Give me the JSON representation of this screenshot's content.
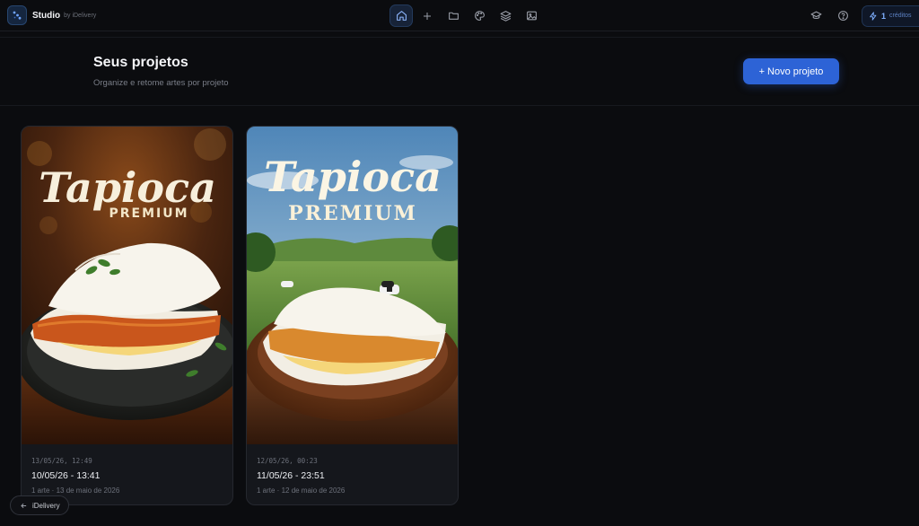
{
  "brand": {
    "name": "Studio",
    "by": "by iDelivery"
  },
  "nav": [
    {
      "icon": "home-icon",
      "active": true
    },
    {
      "icon": "plus-icon",
      "active": false
    },
    {
      "icon": "folder-icon",
      "active": false
    },
    {
      "icon": "palette-icon",
      "active": false
    },
    {
      "icon": "layers-icon",
      "active": false
    },
    {
      "icon": "image-icon",
      "active": false
    }
  ],
  "top_right": {
    "help_icons": [
      "graduation-cap-icon",
      "question-icon"
    ],
    "credits_icon": "lightning-icon",
    "credits_count": "1",
    "credits_label": "créditos"
  },
  "header": {
    "title": "Seus projetos",
    "subtitle": "Organize e retome artes por projeto",
    "new_project_label": "+ Novo projeto"
  },
  "projects": [
    {
      "art_title": "Tapioca",
      "art_subtitle": "PREMIUM",
      "timestamp": "13/05/26, 12:49",
      "name": "10/05/26 - 13:41",
      "summary": "1 arte · 13 de maio de 2026"
    },
    {
      "art_title": "Tapioca",
      "art_subtitle": "PREMIUM",
      "timestamp": "12/05/26, 00:23",
      "name": "11/05/26 - 23:51",
      "summary": "1 arte · 12 de maio de 2026"
    }
  ],
  "footer": {
    "back_label": "iDelivery"
  },
  "colors": {
    "accent": "#2d63d6",
    "background": "#0b0c0f",
    "card": "#15171c"
  }
}
